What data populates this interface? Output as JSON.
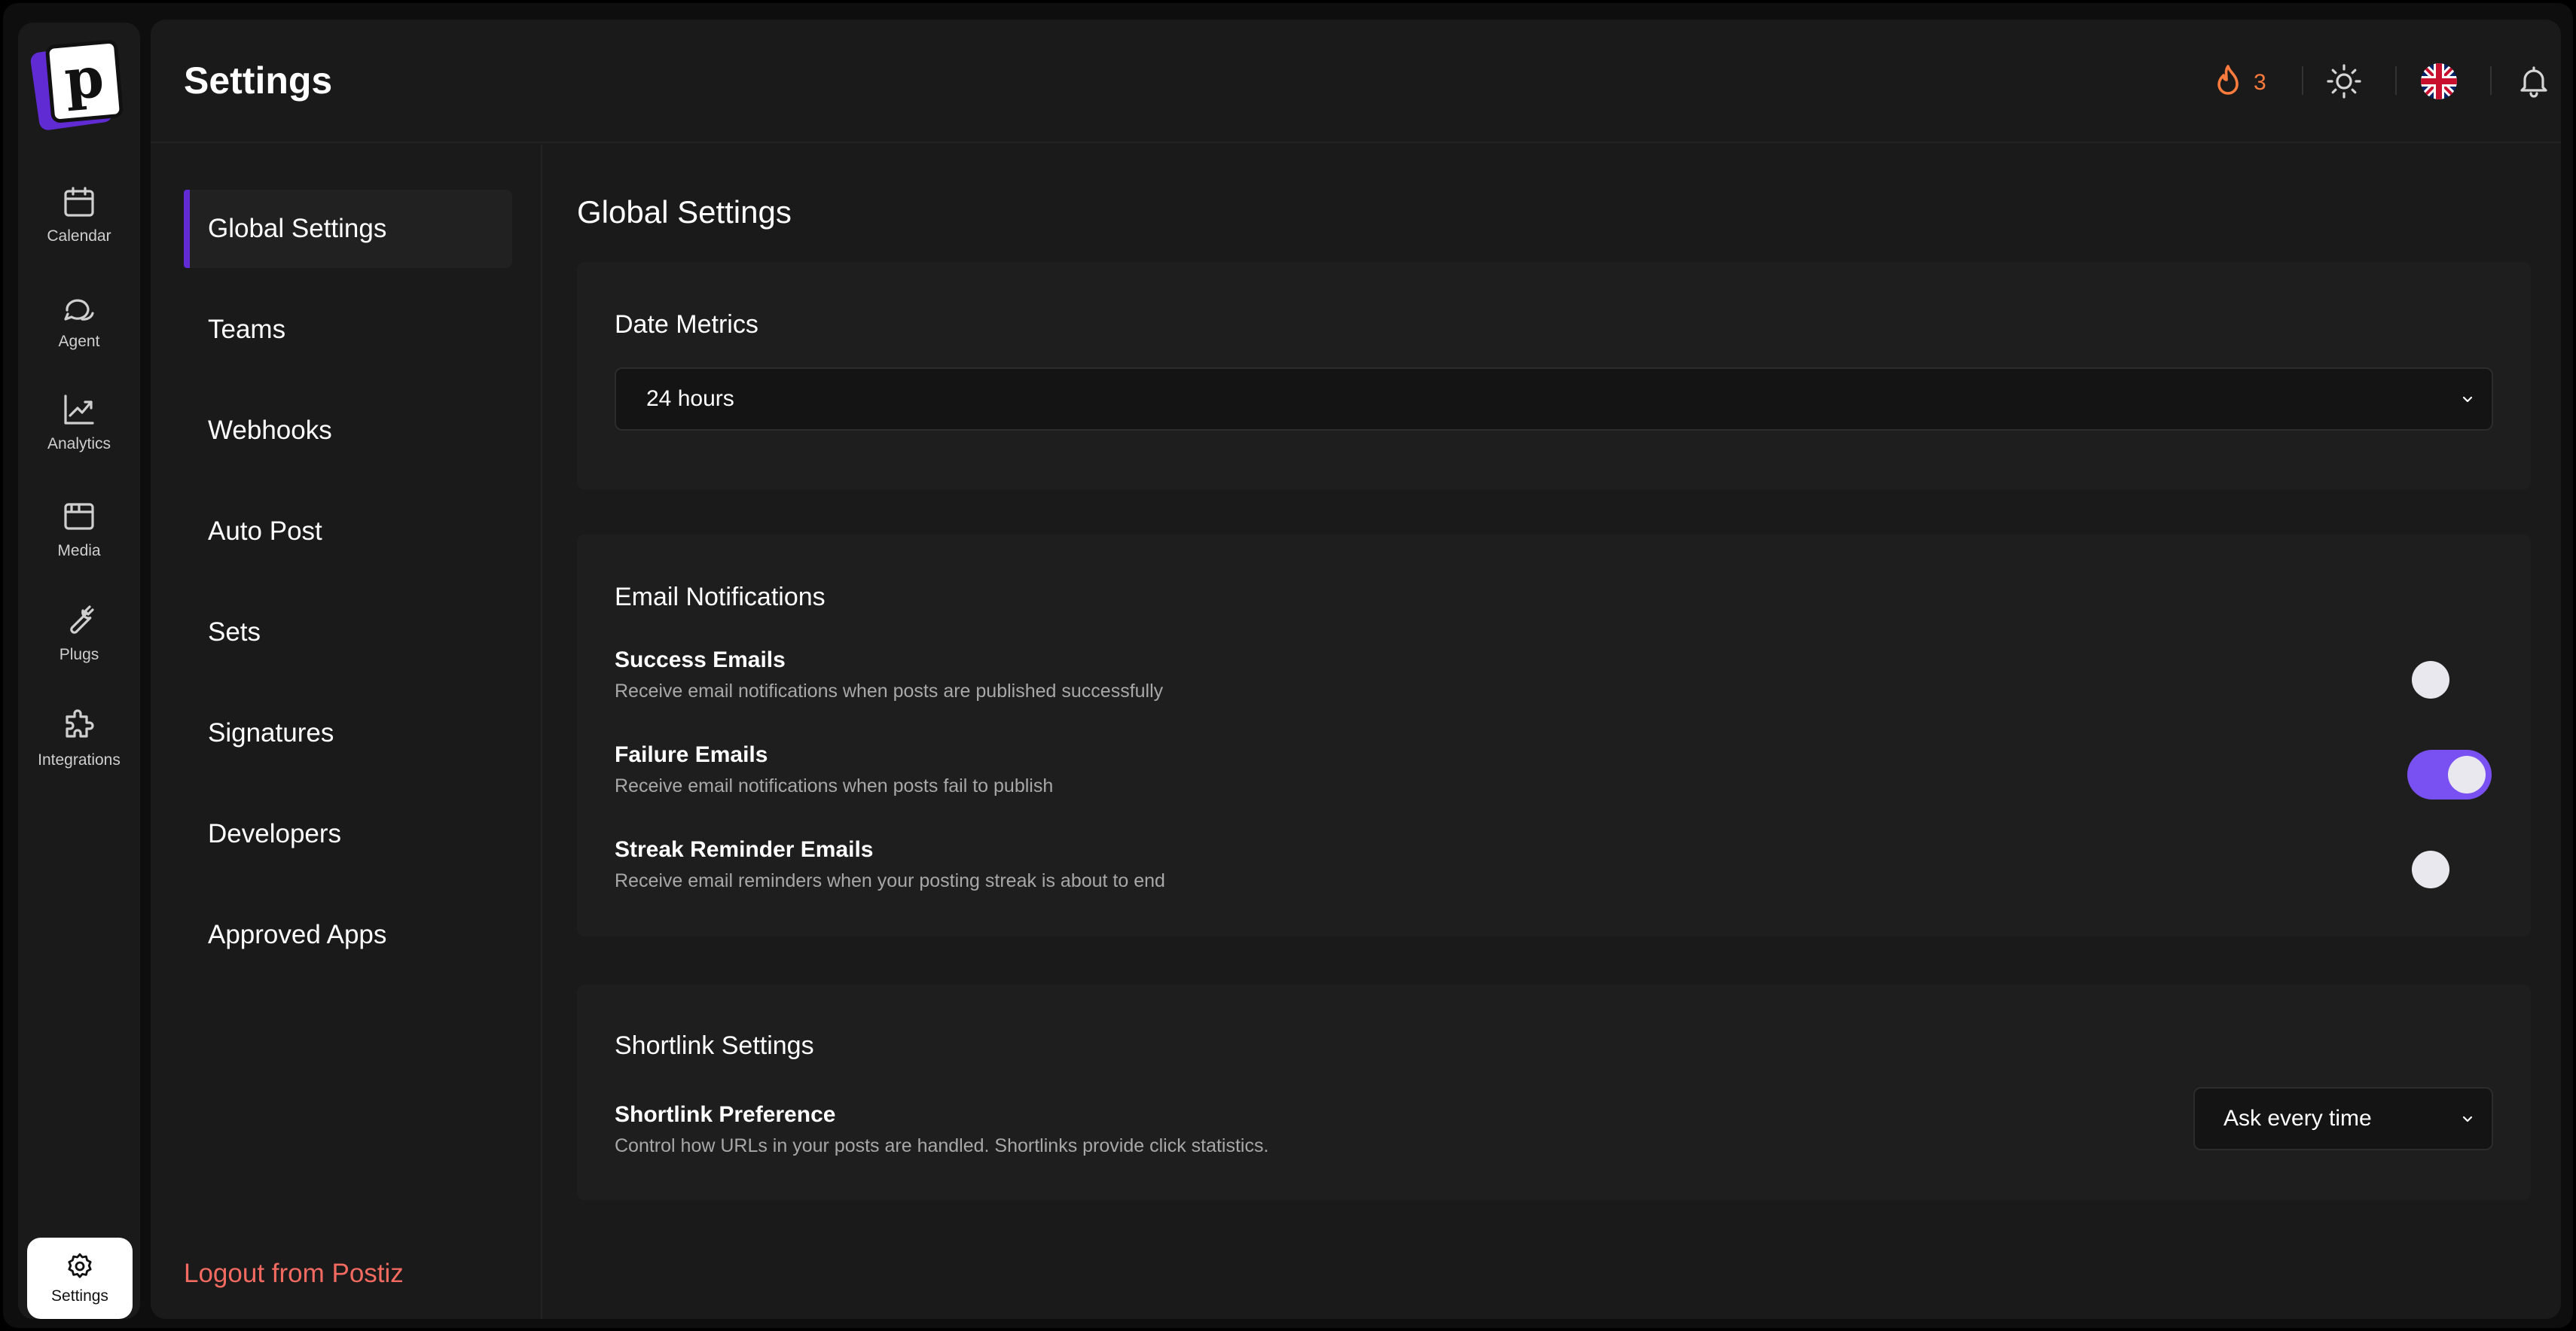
{
  "app": {
    "logo_letter": "p"
  },
  "rail": {
    "items": [
      {
        "label": "Calendar",
        "icon": "calendar-icon"
      },
      {
        "label": "Agent",
        "icon": "chat-icon"
      },
      {
        "label": "Analytics",
        "icon": "chart-icon"
      },
      {
        "label": "Media",
        "icon": "media-icon"
      },
      {
        "label": "Plugs",
        "icon": "wrench-icon"
      },
      {
        "label": "Integrations",
        "icon": "puzzle-icon"
      }
    ],
    "settings_label": "Settings"
  },
  "header": {
    "title": "Settings",
    "streak_count": "3"
  },
  "sidebar": {
    "items": [
      {
        "label": "Global Settings"
      },
      {
        "label": "Teams"
      },
      {
        "label": "Webhooks"
      },
      {
        "label": "Auto Post"
      },
      {
        "label": "Sets"
      },
      {
        "label": "Signatures"
      },
      {
        "label": "Developers"
      },
      {
        "label": "Approved Apps"
      }
    ],
    "logout_label": "Logout from Postiz"
  },
  "content": {
    "title": "Global Settings",
    "date_metrics": {
      "title": "Date Metrics",
      "selected": "24 hours"
    },
    "email_notifications": {
      "title": "Email Notifications",
      "rows": [
        {
          "title": "Success Emails",
          "desc": "Receive email notifications when posts are published successfully",
          "enabled": false
        },
        {
          "title": "Failure Emails",
          "desc": "Receive email notifications when posts fail to publish",
          "enabled": true
        },
        {
          "title": "Streak Reminder Emails",
          "desc": "Receive email reminders when your posting streak is about to end",
          "enabled": false
        }
      ]
    },
    "shortlink": {
      "title": "Shortlink Settings",
      "pref_title": "Shortlink Preference",
      "pref_desc": "Control how URLs in your posts are handled. Shortlinks provide click statistics.",
      "selected": "Ask every time"
    }
  },
  "colors": {
    "accent": "#612bd3",
    "toggle_on": "#7950f2",
    "streak": "#fc7b3d",
    "logout": "#f26a60"
  }
}
